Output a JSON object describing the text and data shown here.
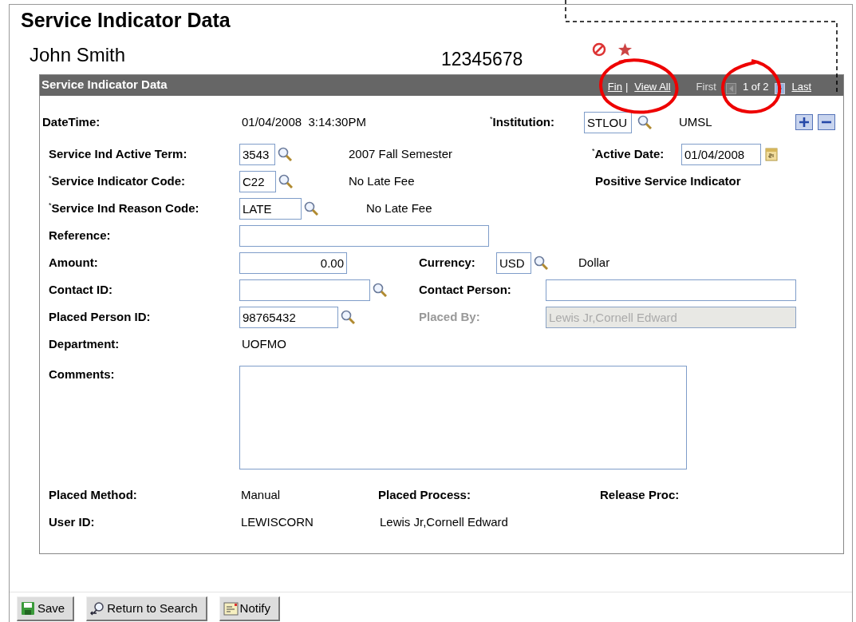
{
  "page_title": "Service Indicator Data",
  "person": {
    "name": "John Smith",
    "id": "12345678"
  },
  "panel": {
    "title": "Service Indicator Data",
    "nav": [
      {
        "kind": "link",
        "text": "Fin",
        "disabled": false
      },
      {
        "kind": "separator",
        "text": "|"
      },
      {
        "kind": "link",
        "text": "View All",
        "disabled": false
      },
      {
        "kind": "link",
        "text": "First",
        "disabled": true
      },
      {
        "kind": "prev",
        "disabled": true
      },
      {
        "kind": "count",
        "text": "1 of 2"
      },
      {
        "kind": "next",
        "disabled": false
      },
      {
        "kind": "link",
        "text": "Last",
        "disabled": false
      }
    ]
  },
  "rows": [
    {
      "items": [
        {
          "kind": "label",
          "text": "DateTime:"
        },
        {
          "kind": "text",
          "text": "01/04/2008  3:14:30PM"
        },
        {
          "kind": "label",
          "text": "$^{*}$Institution:"
        },
        {
          "kind": "input",
          "value": "STLOU"
        },
        {
          "kind": "lookup"
        },
        {
          "kind": "text",
          "text": "UMSL"
        },
        {
          "kind": "add"
        },
        {
          "kind": "remove"
        }
      ]
    },
    {
      "items": [
        {
          "kind": "label",
          "text": "Service Ind Active Term:"
        },
        {
          "kind": "input",
          "value": "3543"
        },
        {
          "kind": "lookup"
        },
        {
          "kind": "text",
          "text": "2007 Fall Semester"
        },
        {
          "kind": "label",
          "text": "$^{*}$Active Date:"
        },
        {
          "kind": "input",
          "value": "01/04/2008"
        },
        {
          "kind": "calendar"
        }
      ]
    },
    {
      "items": [
        {
          "kind": "label",
          "text": "$^{*}$Service Indicator Code:"
        },
        {
          "kind": "input",
          "value": "C22"
        },
        {
          "kind": "lookup"
        },
        {
          "kind": "text",
          "text": "No Late Fee"
        },
        {
          "kind": "bold_text",
          "text": "Positive Service Indicator"
        }
      ]
    },
    {
      "items": [
        {
          "kind": "label",
          "text": "$^{*}$Service Ind Reason Code:"
        },
        {
          "kind": "input",
          "value": "LATE"
        },
        {
          "kind": "lookup"
        },
        {
          "kind": "text",
          "text": "No Late Fee"
        }
      ]
    },
    {
      "items": [
        {
          "kind": "label",
          "text": "Reference:"
        },
        {
          "kind": "input",
          "value": ""
        }
      ]
    },
    {
      "items": [
        {
          "kind": "label",
          "text": "Amount:"
        },
        {
          "kind": "number_input",
          "value": "0.00"
        },
        {
          "kind": "label",
          "text": "Currency:"
        },
        {
          "kind": "input",
          "value": "USD"
        },
        {
          "kind": "lookup"
        },
        {
          "kind": "text",
          "text": "Dollar"
        }
      ]
    },
    {
      "items": [
        {
          "kind": "label",
          "text": "Contact ID:"
        },
        {
          "kind": "input",
          "value": ""
        },
        {
          "kind": "lookup"
        },
        {
          "kind": "label",
          "text": "Contact Person:"
        },
        {
          "kind": "input",
          "value": ""
        }
      ]
    },
    {
      "items": [
        {
          "kind": "label",
          "text": "Placed Person ID:"
        },
        {
          "kind": "input",
          "value": "98765432"
        },
        {
          "kind": "lookup"
        },
        {
          "kind": "muted_label",
          "text": "Placed By:"
        },
        {
          "kind": "readonly_input",
          "value": "Lewis Jr,Cornell Edward"
        }
      ]
    },
    {
      "items": [
        {
          "kind": "label",
          "text": "Department:"
        },
        {
          "kind": "text",
          "text": "UOFMO"
        }
      ]
    },
    {
      "items": [
        {
          "kind": "label",
          "text": "Comments:"
        },
        {
          "kind": "textarea",
          "value": ""
        }
      ]
    },
    {
      "items": [
        {
          "kind": "label",
          "text": "Placed Method:"
        },
        {
          "kind": "text",
          "text": "Manual"
        },
        {
          "kind": "label",
          "text": "Placed Process:"
        },
        {
          "kind": "label",
          "text": "Release Proc:"
        }
      ]
    },
    {
      "items": [
        {
          "kind": "label",
          "text": "User ID:"
        },
        {
          "kind": "text",
          "text": "LEWISCORN"
        },
        {
          "kind": "text",
          "text": "Lewis Jr,Cornell Edward"
        }
      ]
    }
  ],
  "buttons": [
    {
      "kind": "save",
      "label": "Save"
    },
    {
      "kind": "return",
      "label": "Return to Search"
    },
    {
      "kind": "notify",
      "label": "Notify"
    }
  ]
}
